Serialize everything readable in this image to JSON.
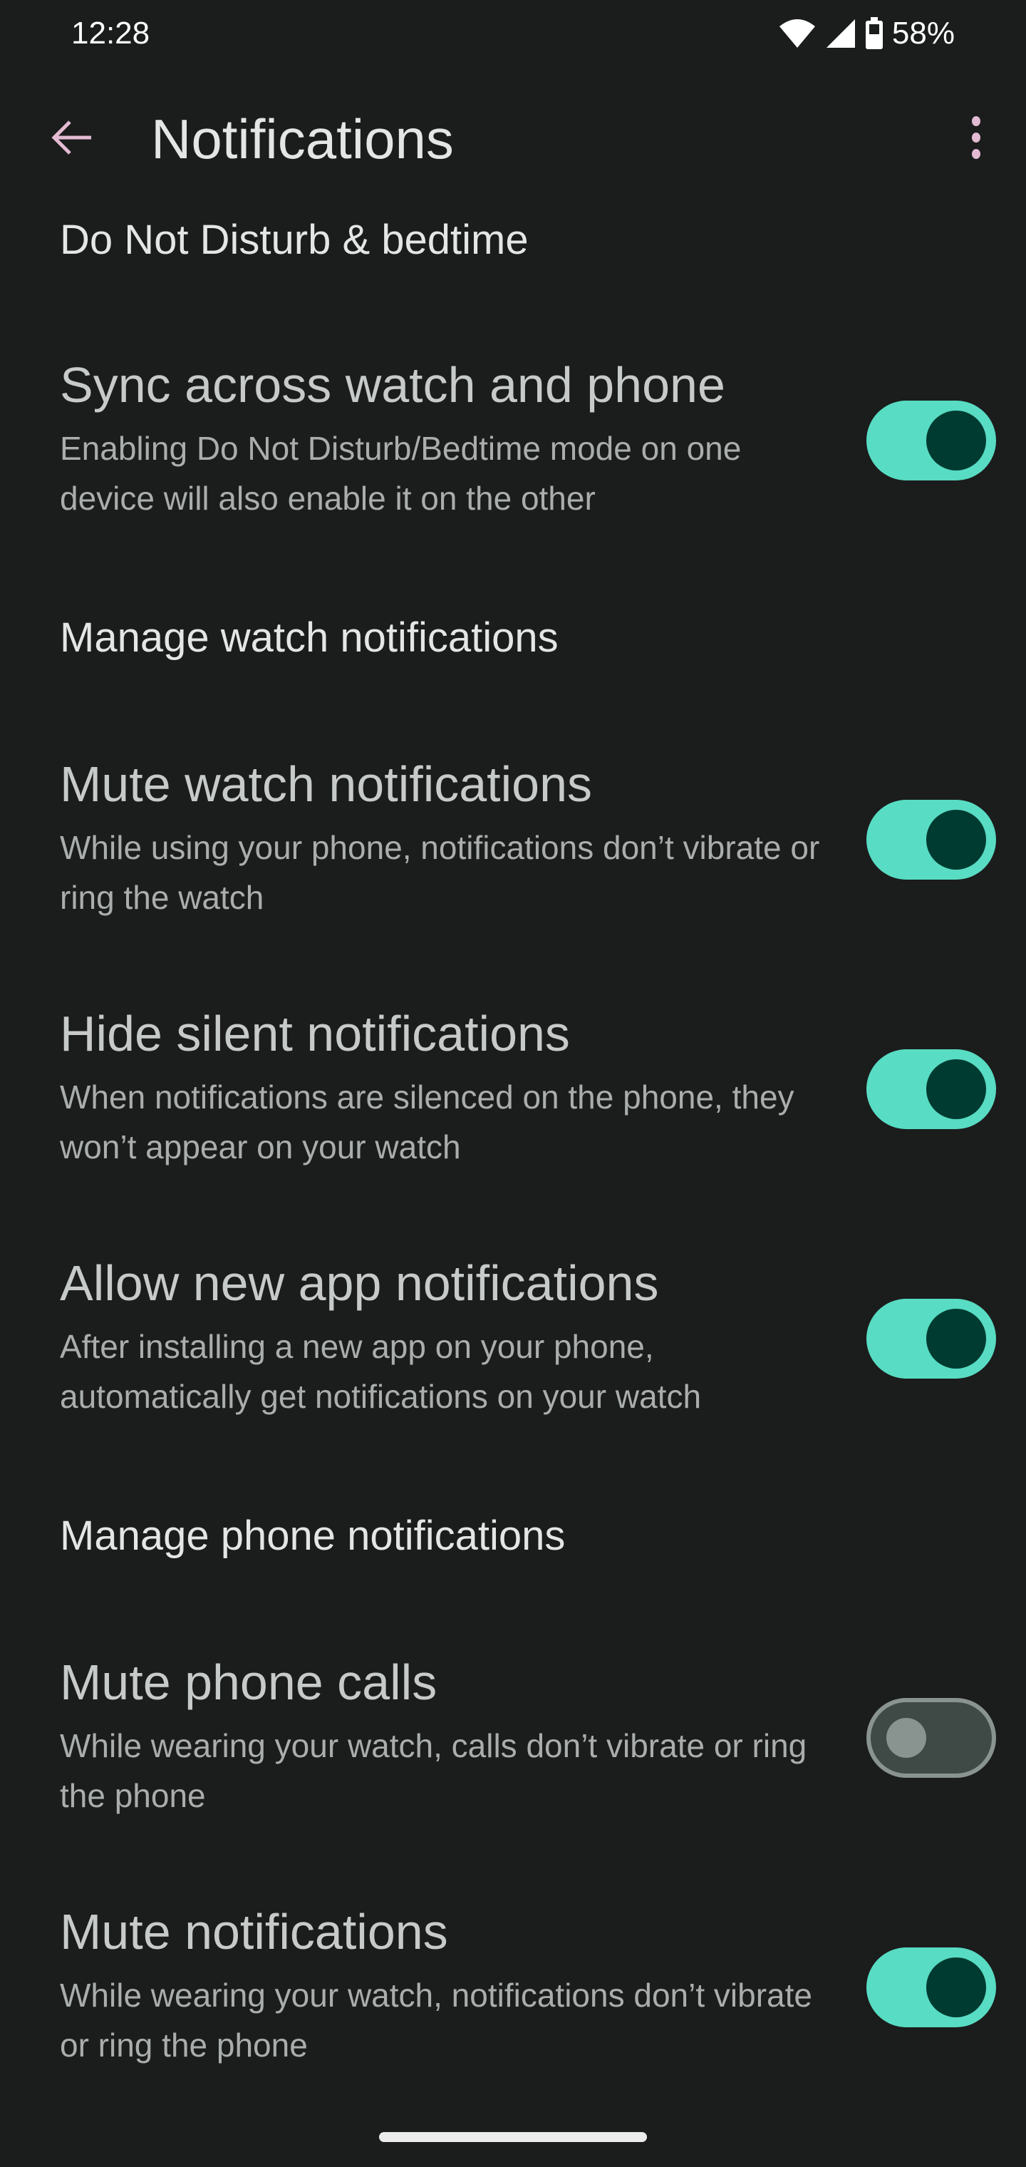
{
  "status_bar": {
    "time": "12:28",
    "battery_percent": "58%",
    "icons": [
      "wifi-icon",
      "cellular-signal-icon",
      "battery-icon"
    ]
  },
  "app_bar": {
    "title": "Notifications",
    "back_icon": "arrow-back-icon",
    "more_icon": "more-vertical-icon",
    "accent_color": "#e2bbd2"
  },
  "sections": [
    {
      "header": "Do Not Disturb & bedtime",
      "items": [
        {
          "title": "Sync across watch and phone",
          "summary": "Enabling Do Not Disturb/Bedtime mode on one device will also enable it on the other",
          "checked": true
        }
      ]
    },
    {
      "header": "Manage watch notifications",
      "items": [
        {
          "title": "Mute watch notifications",
          "summary": "While using your phone, notifications don’t vibrate or ring the watch",
          "checked": true
        },
        {
          "title": "Hide silent notifications",
          "summary": "When notifications are silenced on the phone, they won’t appear on your watch",
          "checked": true
        },
        {
          "title": "Allow new app notifications",
          "summary": "After installing a new app on your phone, automatically get notifications on your watch",
          "checked": true
        }
      ]
    },
    {
      "header": "Manage phone notifications",
      "items": [
        {
          "title": "Mute phone calls",
          "summary": "While wearing your watch, calls don’t vibrate or ring the phone",
          "checked": false
        },
        {
          "title": "Mute notifications",
          "summary": "While wearing your watch, notifications don’t vibrate or ring the phone",
          "checked": true
        }
      ]
    }
  ],
  "colors": {
    "background": "#1b1c1c",
    "toggle_on_track": "#58dcc3",
    "toggle_on_thumb": "#003b31",
    "toggle_off_track": "#3f4946",
    "toggle_off_outline": "#899390"
  }
}
